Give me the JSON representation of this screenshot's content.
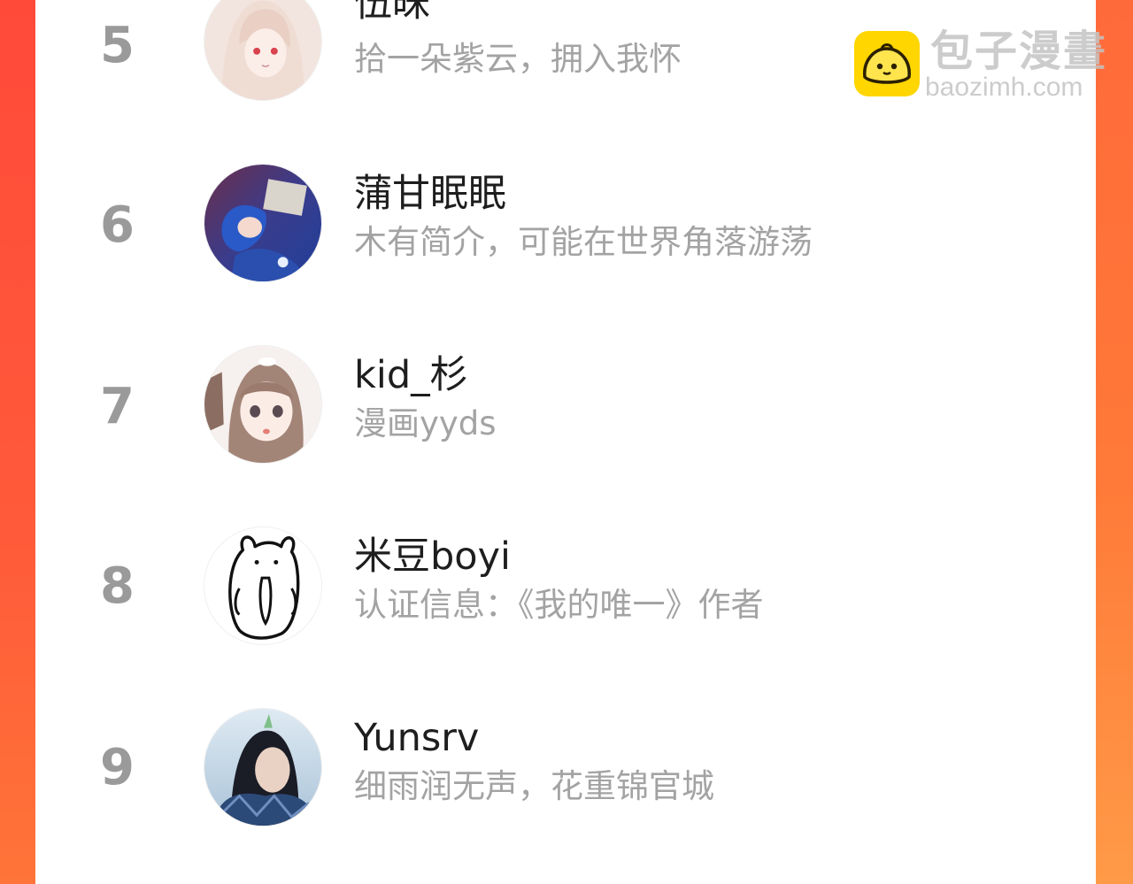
{
  "colors": {
    "accent_left": "#ff4a3a",
    "accent_right": "#ff7a38",
    "panel": "#ffffff",
    "rank": "#9a9a9a",
    "name": "#1e1e1e",
    "bio": "#a3a3a3"
  },
  "watermark": {
    "title": "包子漫畫",
    "url": "baozimh.com",
    "logo_icon": "bun-logo-icon"
  },
  "ranking": [
    {
      "rank": "5",
      "name": "伍昧",
      "bio": "拾一朵紫云，拥入我怀",
      "avatar_icon": "anime-girl-avatar-icon"
    },
    {
      "rank": "6",
      "name": "蒲甘眠眠",
      "bio": "木有简介，可能在世界角落游荡",
      "avatar_icon": "anime-boy-reading-avatar-icon"
    },
    {
      "rank": "7",
      "name": "kid_杉",
      "bio": "漫画yyds",
      "avatar_icon": "anime-girl-brown-hair-avatar-icon"
    },
    {
      "rank": "8",
      "name": "米豆boyi",
      "bio": "认证信息：《我的唯一》作者",
      "avatar_icon": "doodle-bear-avatar-icon"
    },
    {
      "rank": "9",
      "name": "Yunsrv",
      "bio": "细雨润无声，花重锦官城",
      "avatar_icon": "winter-swordsman-avatar-icon"
    }
  ]
}
